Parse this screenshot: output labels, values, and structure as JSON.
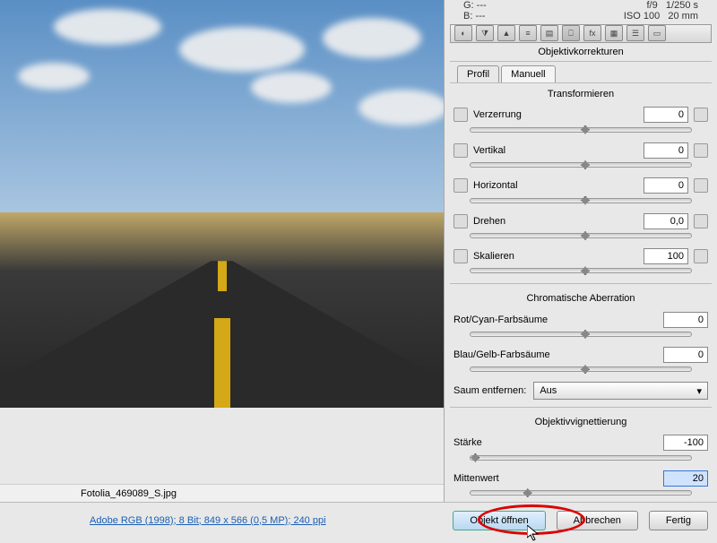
{
  "info": {
    "g": "G:  ---",
    "b": "B:  ---",
    "fstop": "f/9",
    "shutter": "1/250 s",
    "iso": "ISO 100",
    "focal": "20 mm"
  },
  "panel_title": "Objektivkorrekturen",
  "subtabs": {
    "profile": "Profil",
    "manual": "Manuell"
  },
  "sections": {
    "transform": "Transformieren",
    "chromatic": "Chromatische Aberration",
    "vignette": "Objektivvignettierung"
  },
  "controls": {
    "distortion": {
      "label": "Verzerrung",
      "value": "0",
      "pos": 50
    },
    "vertical": {
      "label": "Vertikal",
      "value": "0",
      "pos": 50
    },
    "horizontal": {
      "label": "Horizontal",
      "value": "0",
      "pos": 50
    },
    "rotate": {
      "label": "Drehen",
      "value": "0,0",
      "pos": 50
    },
    "scale": {
      "label": "Skalieren",
      "value": "100",
      "pos": 50
    },
    "redcyan": {
      "label": "Rot/Cyan-Farbsäume",
      "value": "0",
      "pos": 50
    },
    "blueyellow": {
      "label": "Blau/Gelb-Farbsäume",
      "value": "0",
      "pos": 50
    },
    "fringe_label": "Saum entfernen:",
    "fringe_value": "Aus",
    "amount": {
      "label": "Stärke",
      "value": "-100",
      "pos": 2
    },
    "midpoint": {
      "label": "Mittenwert",
      "value": "20",
      "pos": 28
    }
  },
  "filename": "Fotolia_469089_S.jpg",
  "metadata": "Adobe RGB (1998); 8 Bit; 849 x 566 (0,5 MP); 240 ppi",
  "buttons": {
    "open": "Objekt öffnen",
    "cancel": "Abbrechen",
    "done": "Fertig"
  }
}
